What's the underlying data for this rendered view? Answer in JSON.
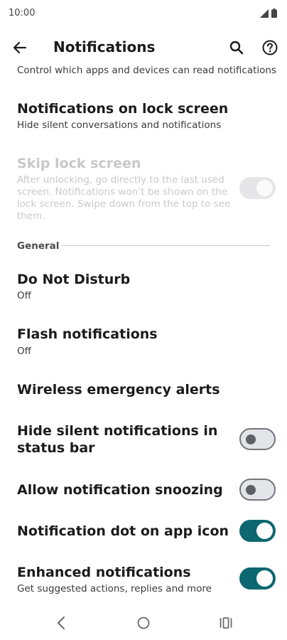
{
  "status_bar": {
    "time": "10:00"
  },
  "app_bar": {
    "title": "Notifications"
  },
  "settings": {
    "partial": {
      "subtitle": "Control which apps and devices can read notifications"
    },
    "lock_screen": {
      "title": "Notifications on lock screen",
      "subtitle": "Hide silent conversations and notifications"
    },
    "skip_lock": {
      "title": "Skip lock screen",
      "subtitle_lines": [
        "After unlocking, go directly to the last used",
        "screen. Notifications won’t be shown on the",
        "lock screen. Swipe down from the top to see",
        "them."
      ],
      "toggle": "on",
      "enabled": false
    },
    "section_general": "General",
    "dnd": {
      "title": "Do Not Disturb",
      "subtitle": "Off"
    },
    "flash": {
      "title": "Flash notifications",
      "subtitle": "Off"
    },
    "emergency": {
      "title": "Wireless emergency alerts"
    },
    "hide_silent": {
      "title_lines": [
        "Hide silent notifications in",
        "status bar"
      ],
      "toggle": "off"
    },
    "snoozing": {
      "title": "Allow notification snoozing",
      "toggle": "off"
    },
    "dot": {
      "title": "Notification dot on app icon",
      "toggle": "on"
    },
    "enhanced": {
      "title": "Enhanced notifications",
      "subtitle": "Get suggested actions, replies and more",
      "toggle": "on"
    }
  },
  "icons": {
    "back": "arrow-left-icon",
    "search": "search-icon",
    "help": "help-circle-icon",
    "signal": "signal-icon",
    "battery": "battery-icon"
  },
  "colors": {
    "accent": "#0c6770",
    "toggle_off_track": "#e3e5e8"
  }
}
